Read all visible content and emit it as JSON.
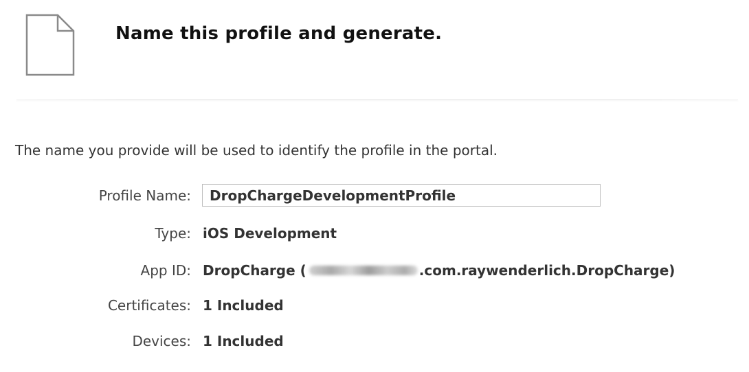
{
  "header": {
    "title": "Name this profile and generate."
  },
  "description": "The name you provide will be used to identify the profile in the portal.",
  "form": {
    "profile_name": {
      "label": "Profile Name:",
      "value": "DropChargeDevelopmentProfile"
    },
    "type": {
      "label": "Type:",
      "value": "iOS Development"
    },
    "app_id": {
      "label": "App ID:",
      "prefix": "DropCharge (",
      "suffix": ".com.raywenderlich.DropCharge)"
    },
    "certificates": {
      "label": "Certificates:",
      "value": "1 Included"
    },
    "devices": {
      "label": "Devices:",
      "value": "1 Included"
    }
  },
  "icons": {
    "header_icon": "document-icon"
  }
}
